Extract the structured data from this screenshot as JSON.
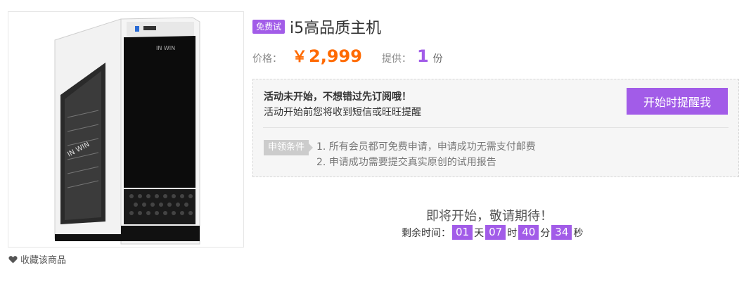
{
  "product": {
    "badge": "免费试",
    "title": "i5高品质主机",
    "image_brand": "IN WIN"
  },
  "price": {
    "label": "价格：",
    "currency": "￥",
    "value": "2,999"
  },
  "supply": {
    "label": "提供：",
    "count": "1",
    "unit": "份"
  },
  "notice": {
    "title": "活动未开始，不想错过先订阅哦！",
    "subtitle": "活动开始前您将收到短信或旺旺提醒",
    "remind_button": "开始时提醒我",
    "conditions_label": "申领条件",
    "conditions": [
      "1. 所有会员都可免费申请，申请成功无需支付邮费",
      "2. 申请成功需要提交真实原创的试用报告"
    ]
  },
  "countdown": {
    "headline": "即将开始，敬请期待！",
    "label": "剩余时间：",
    "days": "01",
    "days_unit": "天",
    "hours": "07",
    "hours_unit": "时",
    "minutes": "40",
    "minutes_unit": "分",
    "seconds": "34",
    "seconds_unit": "秒"
  },
  "favorite": {
    "label": "收藏该商品"
  },
  "colors": {
    "accent": "#a25ce8",
    "price": "#ff6a00"
  }
}
